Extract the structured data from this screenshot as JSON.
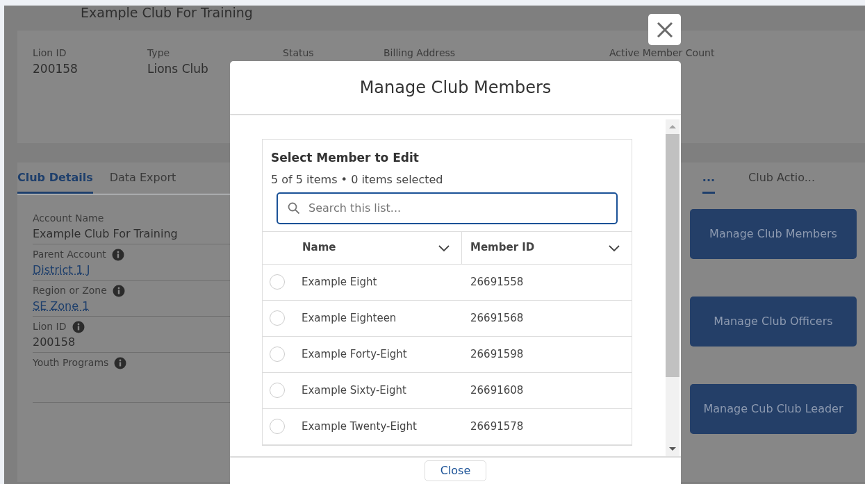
{
  "page": {
    "title": "Example Club For Training"
  },
  "highlights": [
    {
      "label": "Lion ID",
      "value": "200158"
    },
    {
      "label": "Type",
      "value": "Lions Club"
    },
    {
      "label": "Status"
    },
    {
      "label": "Billing Address"
    },
    {
      "label": "Active Member Count"
    }
  ],
  "left_tabs": [
    {
      "label": "Club Details",
      "selected": true
    },
    {
      "label": "Data Export",
      "selected": false
    }
  ],
  "details": [
    {
      "label": "Account Name",
      "info": false,
      "value": "Example Club For Training",
      "link": false
    },
    {
      "label": "Parent Account",
      "info": true,
      "value": "District 1 J",
      "link": true
    },
    {
      "label": "Region or Zone",
      "info": true,
      "value": "SE Zone 1",
      "link": true
    },
    {
      "label": "Lion ID",
      "info": true,
      "value": "200158",
      "link": false
    },
    {
      "label": "Youth Programs",
      "info": true
    }
  ],
  "right_tabs": [
    {
      "label": "...",
      "selected": true
    },
    {
      "label": "Club Actio...",
      "selected": false
    }
  ],
  "actions": [
    "Manage Club Members",
    "Manage Club Officers",
    "Manage Cub Club Leader"
  ],
  "modal": {
    "title": "Manage Club Members",
    "list_title": "Select Member to Edit",
    "count": "5 of 5 items • 0 items selected",
    "search": {
      "placeholder": "Search this list..."
    },
    "columns": [
      "Name",
      "Member ID"
    ],
    "rows": [
      {
        "name": "Example Eight",
        "member_id": "26691558",
        "selected": false
      },
      {
        "name": "Example Eighteen",
        "member_id": "26691568",
        "selected": false
      },
      {
        "name": "Example Forty-Eight",
        "member_id": "26691598",
        "selected": false
      },
      {
        "name": "Example Sixty-Eight",
        "member_id": "26691608",
        "selected": false
      },
      {
        "name": "Example Twenty-Eight",
        "member_id": "26691578",
        "selected": false
      }
    ],
    "close": "Close"
  }
}
